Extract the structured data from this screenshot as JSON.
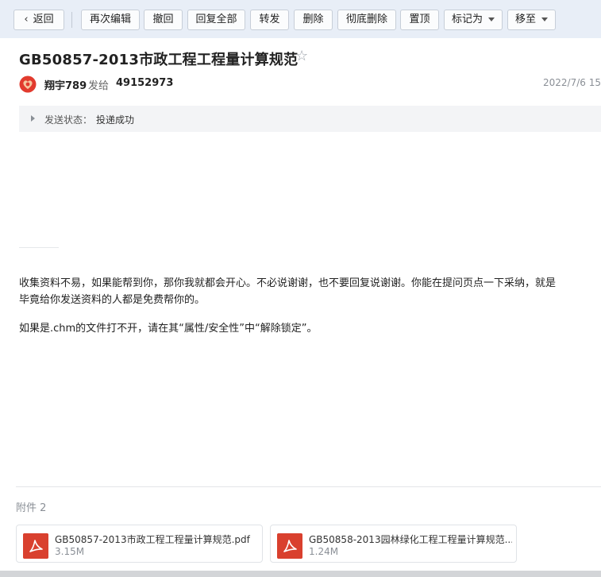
{
  "toolbar": {
    "back": "返回",
    "buttons": [
      "再次编辑",
      "撤回",
      "回复全部",
      "转发",
      "删除",
      "彻底删除",
      "置顶"
    ],
    "mark_as": "标记为",
    "move_to": "移至"
  },
  "mail": {
    "subject": "GB50857-2013市政工程工程量计算规范",
    "sender": "翔宇789",
    "sent_to_label": "发给",
    "recipient": "49152973",
    "date": "2022/7/6 15"
  },
  "status": {
    "label": "发送状态：",
    "value": "投递成功"
  },
  "body": {
    "para1_line1": "收集资料不易，如果能帮到你，那你我就都会开心。不必说谢谢，也不要回复说谢谢。你能在提问页点一下采纳，就是",
    "para1_line2": "毕竟给你发送资料的人都是免费帮你的。",
    "para2": "如果是.chm的文件打不开，请在其“属性/安全性”中“解除锁定”。"
  },
  "attachments": {
    "count_label": "附件 2",
    "items": [
      {
        "name": "GB50857-2013市政工程工程量计算规范.pdf",
        "size": "3.15M"
      },
      {
        "name": "GB50858-2013园林绿化工程工程量计算规范....",
        "size": "1.24M"
      }
    ]
  },
  "colors": {
    "toolbar_bg": "#e8eef7",
    "pdf_red": "#d9402e",
    "status_bg": "#f3f4f6"
  },
  "icons": [
    "chevron-left-icon",
    "star-icon",
    "avatar-icon",
    "caret-down-icon",
    "pdf-icon",
    "triangle-right-icon"
  ]
}
